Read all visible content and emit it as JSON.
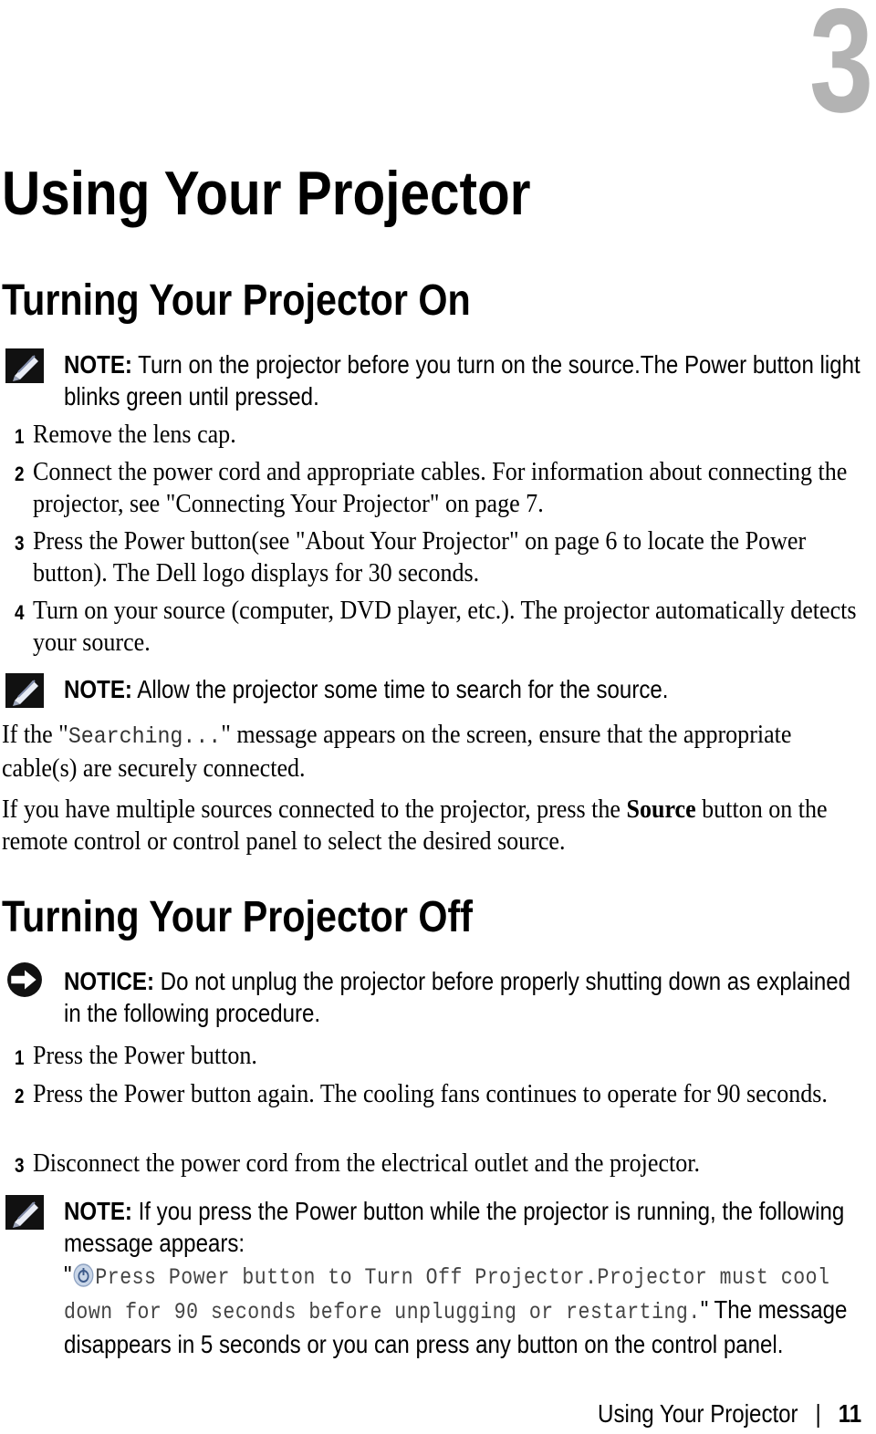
{
  "chapter_number": "3",
  "chapter_title": "Using Your Projector",
  "sections": {
    "on": {
      "heading": "Turning Your Projector On",
      "note1": {
        "label": "NOTE:",
        "text": " Turn on the projector before you turn on the source.The Power button light blinks green until pressed."
      },
      "steps": [
        {
          "num": "1",
          "text": "Remove the lens cap."
        },
        {
          "num": "2",
          "text": "Connect the power cord and appropriate cables. For information about connecting the projector, see \"Connecting Your Projector\" on page 7."
        },
        {
          "num": "3",
          "text": "Press the Power button(see \"About Your Projector\" on page 6 to locate the Power button). The Dell logo displays for 30 seconds."
        },
        {
          "num": "4",
          "text": "Turn on your source (computer, DVD player, etc.). The projector automatically detects your source."
        }
      ],
      "note2": {
        "label": "NOTE:",
        "text": " Allow the projector some time to search for the source."
      },
      "para1": {
        "before": "If the \"",
        "code": "Searching...",
        "after": "\" message appears on the screen, ensure that the appropriate cable(s) are securely connected."
      },
      "para2": {
        "before": "If you have multiple sources connected to the projector, press the ",
        "bold": "Source",
        "after": " button on the remote control or control panel to select the desired source."
      }
    },
    "off": {
      "heading": "Turning Your Projector Off",
      "notice": {
        "label": "NOTICE:",
        "text": " Do not unplug the projector before properly shutting down as explained in the following procedure."
      },
      "steps": [
        {
          "num": "1",
          "text": "Press the Power button."
        },
        {
          "num": "2",
          "text": "Press the Power button again. The cooling fans continues to operate for 90 seconds."
        },
        {
          "num": "3",
          "text": "Disconnect the power cord from the electrical outlet and the projector."
        }
      ],
      "note3": {
        "label": "NOTE:",
        "text": " If you press the Power button while the projector is running, the following message appears:",
        "quote_open": "\"",
        "message": "Press Power button to Turn Off Projector.Projector must cool down for 90 seconds before unplugging or restarting.",
        "quote_close": "\"",
        "after": " The message disappears in 5 seconds or you can press any button on the control panel."
      }
    }
  },
  "footer": {
    "title": "Using Your Projector",
    "separator": "|",
    "page": "11"
  },
  "icons": {
    "note": "pencil-note-icon",
    "notice": "arrow-notice-icon",
    "power": "power-icon"
  },
  "colors": {
    "chapter_number": "#b3b3b3",
    "text": "#000000"
  }
}
